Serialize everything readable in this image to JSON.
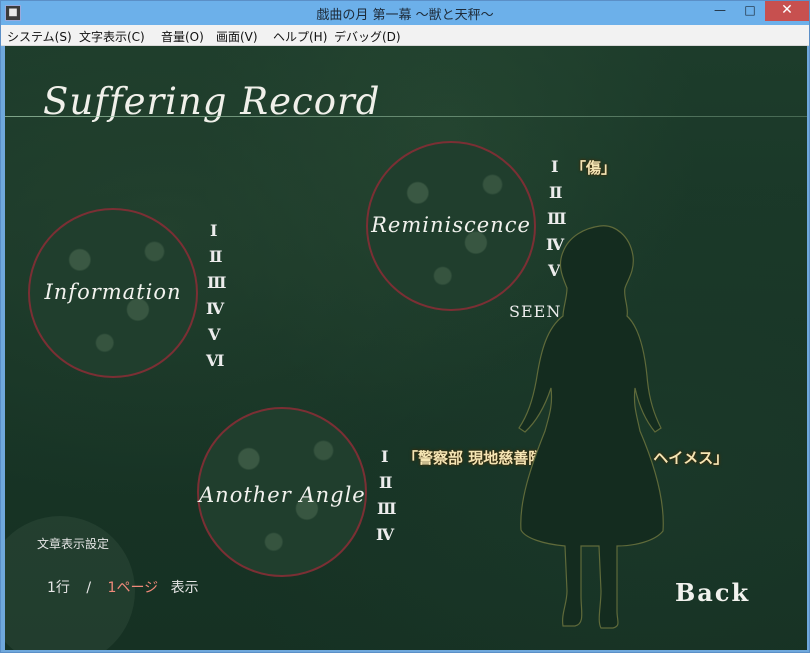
{
  "window": {
    "title": "戯曲の月 第一幕 ～獣と天秤～",
    "minimize_glyph": "—",
    "maximize_glyph": "□",
    "close_glyph": "✕",
    "app_icon": "app-icon"
  },
  "menu": {
    "items": [
      "システム(S)",
      "文字表示(C)",
      "音量(O)",
      "画面(V)",
      "ヘルプ(H)",
      "デバッグ(D)"
    ]
  },
  "screen": {
    "title": "Suffering Record",
    "sections": {
      "information": {
        "label": "Information",
        "numerals": [
          "Ⅰ",
          "Ⅱ",
          "Ⅲ",
          "Ⅳ",
          "Ⅴ",
          "Ⅵ"
        ]
      },
      "reminiscence": {
        "label": "Reminiscence",
        "numerals": [
          "Ⅰ",
          "Ⅱ",
          "Ⅲ",
          "Ⅳ",
          "Ⅴ"
        ],
        "first_entry": "「傷」",
        "seen_label": "SEEN"
      },
      "another_angle": {
        "label": "Another Angle",
        "numerals": [
          "Ⅰ",
          "Ⅱ",
          "Ⅲ",
          "Ⅳ"
        ],
        "first_entry": "「警察部 現地慈善隊中佐 チャット・ヘイメス」"
      }
    },
    "text_settings": {
      "title": "文章表示設定",
      "lines_value": "1行",
      "separator": "/",
      "page_value": "1ページ",
      "suffix": "表示"
    },
    "back_label": "Back"
  },
  "colors": {
    "background": "#183526",
    "circle_border": "#7b2f34",
    "entry_text": "#f5e5b4",
    "accent": "#f08a7a"
  }
}
